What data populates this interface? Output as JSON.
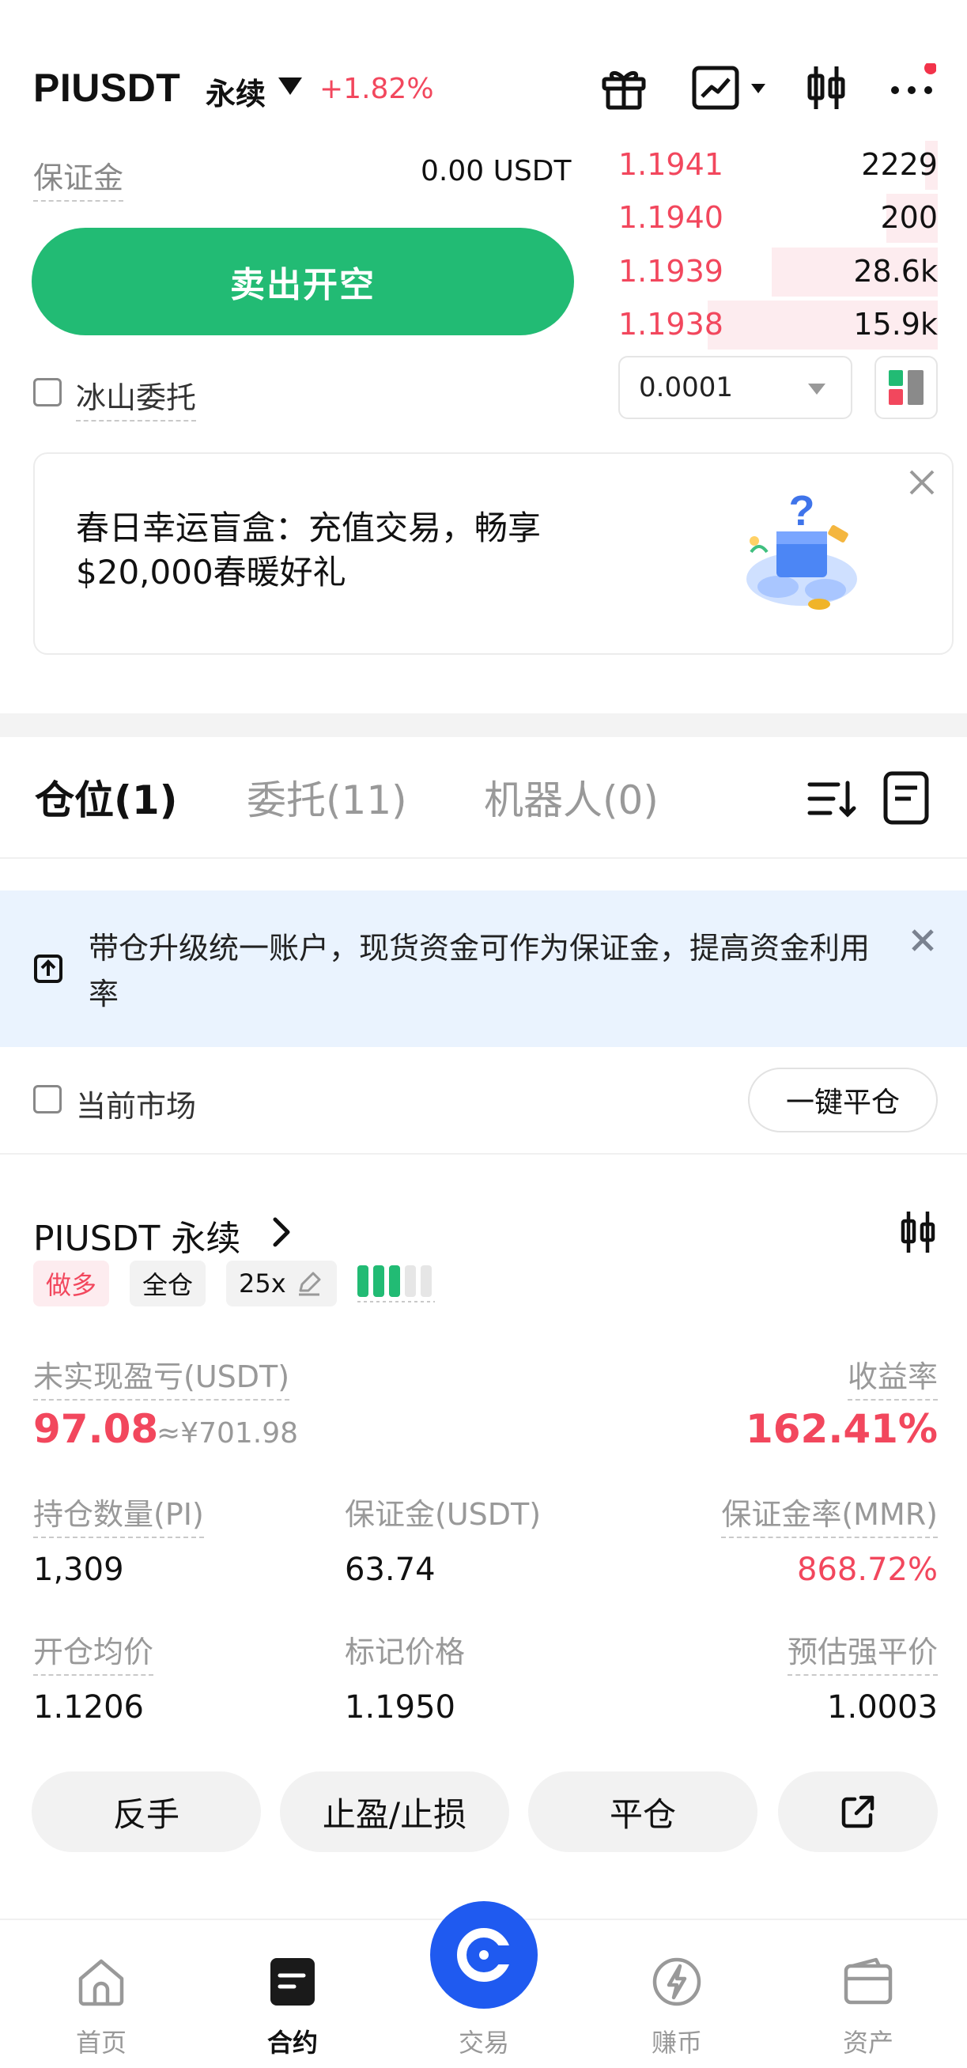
{
  "header": {
    "symbol": "PIUSDT",
    "contract_type": "永续",
    "change_pct": "+1.82%"
  },
  "trade_panel": {
    "margin_label": "保证金",
    "margin_value": "0.00 USDT",
    "sell_button": "卖出开空",
    "iceberg_label": "冰山委托"
  },
  "order_book": {
    "asks": [
      {
        "price": "1.1941",
        "qty": "2229",
        "depth": 0.04
      },
      {
        "price": "1.1940",
        "qty": "200",
        "depth": 0.16
      },
      {
        "price": "1.1939",
        "qty": "28.6k",
        "depth": 0.52
      },
      {
        "price": "1.1938",
        "qty": "15.9k",
        "depth": 0.72
      }
    ],
    "precision": "0.0001"
  },
  "promo": {
    "text": "春日幸运盲盒：充值交易，畅享$20,000春暖好礼"
  },
  "tabs": {
    "positions": "仓位(1)",
    "orders": "委托(11)",
    "bots": "机器人(0)"
  },
  "upgrade_banner": {
    "text": "带仓升级统一账户，现货资金可作为保证金，提高资金利用率"
  },
  "filter": {
    "current_market": "当前市场",
    "close_all": "一键平仓"
  },
  "position": {
    "title": "PIUSDT 永续",
    "side": "做多",
    "margin_mode": "全仓",
    "leverage": "25x",
    "risk_level_bars": 3,
    "unrealized_pnl_label": "未实现盈亏(USDT)",
    "unrealized_pnl": "97.08",
    "unrealized_pnl_cny": "≈¥701.98",
    "roi_label": "收益率",
    "roi": "162.41%",
    "size_label": "持仓数量(PI)",
    "size": "1,309",
    "margin_label": "保证金(USDT)",
    "margin": "63.74",
    "mmr_label": "保证金率(MMR)",
    "mmr": "868.72%",
    "entry_label": "开仓均价",
    "entry": "1.1206",
    "mark_label": "标记价格",
    "mark": "1.1950",
    "liq_label": "预估强平价",
    "liq": "1.0003",
    "actions": {
      "reverse": "反手",
      "tpsl": "止盈/止损",
      "close": "平仓"
    }
  },
  "bottom_nav": {
    "home": "首页",
    "contracts": "合约",
    "trade": "交易",
    "earn": "赚币",
    "assets": "资产"
  },
  "colors": {
    "green": "#22bb74",
    "red": "#f2475d",
    "blue": "#1f5af0"
  }
}
